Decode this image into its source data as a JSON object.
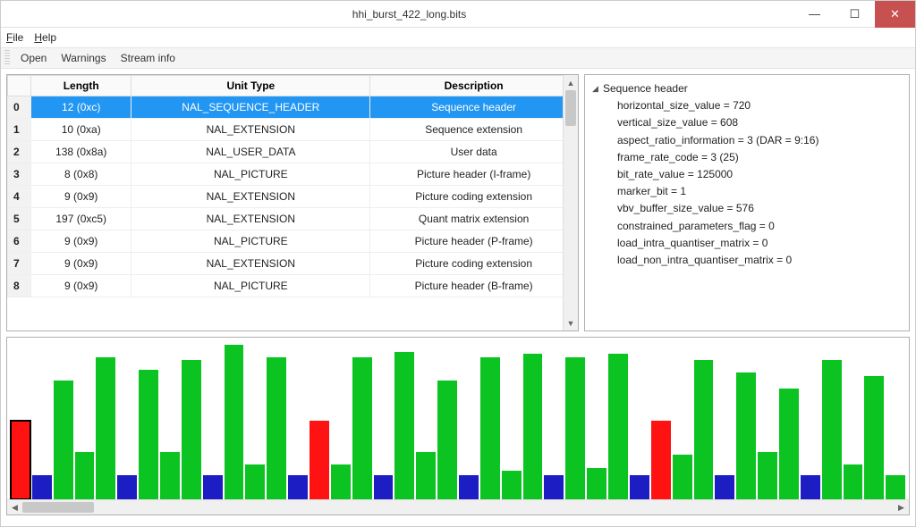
{
  "window": {
    "title": "hhi_burst_422_long.bits"
  },
  "menu": {
    "file": "File",
    "help": "Help"
  },
  "toolbar": {
    "open": "Open",
    "warnings": "Warnings",
    "stream_info": "Stream info"
  },
  "table": {
    "headers": {
      "length": "Length",
      "unit_type": "Unit Type",
      "description": "Description"
    },
    "rows": [
      {
        "idx": "0",
        "length": "12 (0xc)",
        "unit_type": "NAL_SEQUENCE_HEADER",
        "description": "Sequence header",
        "selected": true
      },
      {
        "idx": "1",
        "length": "10 (0xa)",
        "unit_type": "NAL_EXTENSION",
        "description": "Sequence extension",
        "selected": false
      },
      {
        "idx": "2",
        "length": "138 (0x8a)",
        "unit_type": "NAL_USER_DATA",
        "description": "User data",
        "selected": false
      },
      {
        "idx": "3",
        "length": "8 (0x8)",
        "unit_type": "NAL_PICTURE",
        "description": "Picture header (I-frame)",
        "selected": false
      },
      {
        "idx": "4",
        "length": "9 (0x9)",
        "unit_type": "NAL_EXTENSION",
        "description": "Picture coding extension",
        "selected": false
      },
      {
        "idx": "5",
        "length": "197 (0xc5)",
        "unit_type": "NAL_EXTENSION",
        "description": "Quant matrix extension",
        "selected": false
      },
      {
        "idx": "6",
        "length": "9 (0x9)",
        "unit_type": "NAL_PICTURE",
        "description": "Picture header (P-frame)",
        "selected": false
      },
      {
        "idx": "7",
        "length": "9 (0x9)",
        "unit_type": "NAL_EXTENSION",
        "description": "Picture coding extension",
        "selected": false
      },
      {
        "idx": "8",
        "length": "9 (0x9)",
        "unit_type": "NAL_PICTURE",
        "description": "Picture header (B-frame)",
        "selected": false
      }
    ]
  },
  "tree": {
    "root": "Sequence header",
    "items": [
      "horizontal_size_value = 720",
      "vertical_size_value = 608",
      "aspect_ratio_information = 3 (DAR = 9:16)",
      "frame_rate_code = 3 (25)",
      "bit_rate_value = 125000",
      "marker_bit = 1",
      "vbv_buffer_size_value = 576",
      "constrained_parameters_flag = 0",
      "load_intra_quantiser_matrix = 0",
      "load_non_intra_quantiser_matrix = 0"
    ]
  },
  "chart_data": {
    "type": "bar",
    "title": "",
    "xlabel": "",
    "ylabel": "",
    "ylim": [
      0,
      100
    ],
    "series": [
      {
        "name": "unit-size",
        "values": [
          {
            "h": 50,
            "color": "red",
            "selected": true
          },
          {
            "h": 15,
            "color": "blue"
          },
          {
            "h": 75,
            "color": "green"
          },
          {
            "h": 30,
            "color": "green"
          },
          {
            "h": 90,
            "color": "green"
          },
          {
            "h": 15,
            "color": "blue"
          },
          {
            "h": 82,
            "color": "green"
          },
          {
            "h": 30,
            "color": "green"
          },
          {
            "h": 88,
            "color": "green"
          },
          {
            "h": 15,
            "color": "blue"
          },
          {
            "h": 98,
            "color": "green"
          },
          {
            "h": 22,
            "color": "green"
          },
          {
            "h": 90,
            "color": "green"
          },
          {
            "h": 15,
            "color": "blue"
          },
          {
            "h": 50,
            "color": "red"
          },
          {
            "h": 22,
            "color": "green"
          },
          {
            "h": 90,
            "color": "green"
          },
          {
            "h": 15,
            "color": "blue"
          },
          {
            "h": 93,
            "color": "green"
          },
          {
            "h": 30,
            "color": "green"
          },
          {
            "h": 75,
            "color": "green"
          },
          {
            "h": 15,
            "color": "blue"
          },
          {
            "h": 90,
            "color": "green"
          },
          {
            "h": 18,
            "color": "green"
          },
          {
            "h": 92,
            "color": "green"
          },
          {
            "h": 15,
            "color": "blue"
          },
          {
            "h": 90,
            "color": "green"
          },
          {
            "h": 20,
            "color": "green"
          },
          {
            "h": 92,
            "color": "green"
          },
          {
            "h": 15,
            "color": "blue"
          },
          {
            "h": 50,
            "color": "red"
          },
          {
            "h": 28,
            "color": "green"
          },
          {
            "h": 88,
            "color": "green"
          },
          {
            "h": 15,
            "color": "blue"
          },
          {
            "h": 80,
            "color": "green"
          },
          {
            "h": 30,
            "color": "green"
          },
          {
            "h": 70,
            "color": "green"
          },
          {
            "h": 15,
            "color": "blue"
          },
          {
            "h": 88,
            "color": "green"
          },
          {
            "h": 22,
            "color": "green"
          },
          {
            "h": 78,
            "color": "green"
          },
          {
            "h": 15,
            "color": "green"
          }
        ]
      }
    ]
  },
  "colors": {
    "sel_bg": "#2196f3",
    "green": "#0cc421",
    "blue": "#1d1dc4",
    "red": "#ff1212"
  }
}
